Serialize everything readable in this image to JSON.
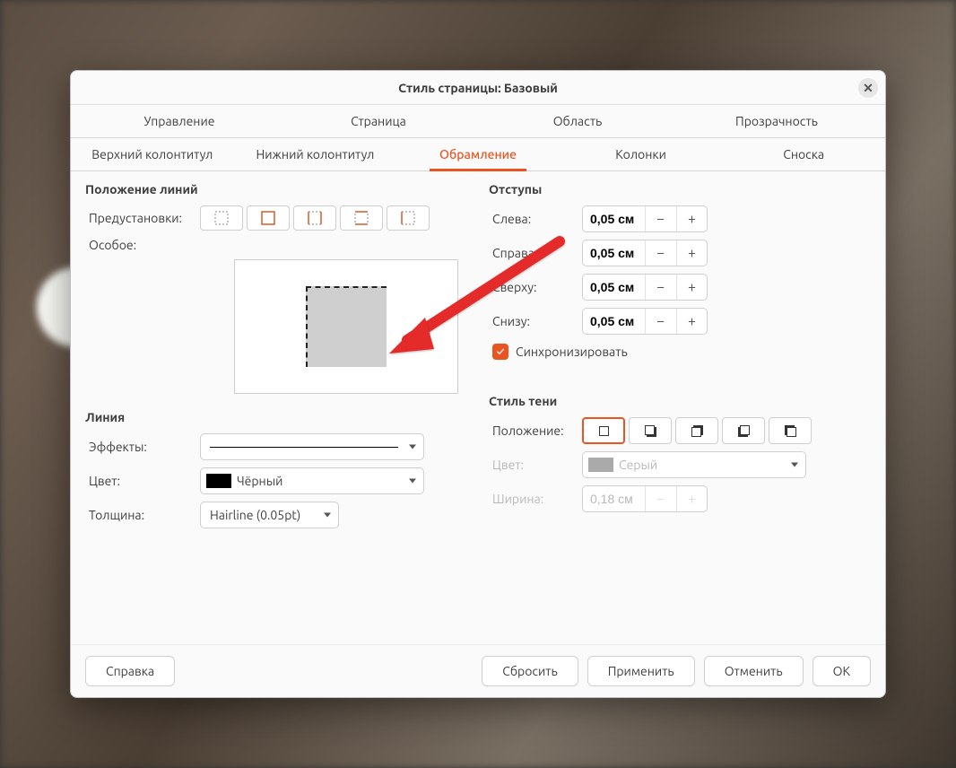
{
  "title": "Стиль страницы: Базовый",
  "tabsRow1": [
    "Управление",
    "Страница",
    "Область",
    "Прозрачность"
  ],
  "tabsRow2": [
    "Верхний колонтитул",
    "Нижний колонтитул",
    "Обрамление",
    "Колонки",
    "Сноска"
  ],
  "activeTab": "Обрамление",
  "lineArrangement": {
    "heading": "Положение линий",
    "presetsLabel": "Предустановки:",
    "customLabel": "Особое:"
  },
  "line": {
    "heading": "Линия",
    "effectsLabel": "Эффекты:",
    "colorLabel": "Цвет:",
    "colorValue": "Чёрный",
    "widthLabel": "Толщина:",
    "widthValue": "Hairline (0.05pt)"
  },
  "padding": {
    "heading": "Отступы",
    "leftLabel": "Слева:",
    "leftValue": "0,05 см",
    "rightLabel": "Справа:",
    "rightValue": "0,05 см",
    "topLabel": "Сверху:",
    "topValue": "0,05 см",
    "bottomLabel": "Снизу:",
    "bottomValue": "0,05 см",
    "syncLabel": "Синхронизировать"
  },
  "shadow": {
    "heading": "Стиль тени",
    "positionLabel": "Положение:",
    "colorLabel": "Цвет:",
    "colorValue": "Серый",
    "widthLabel": "Ширина:",
    "widthValue": "0,18 см"
  },
  "footer": {
    "help": "Справка",
    "reset": "Сбросить",
    "apply": "Применить",
    "cancel": "Отменить",
    "ok": "ОК"
  }
}
